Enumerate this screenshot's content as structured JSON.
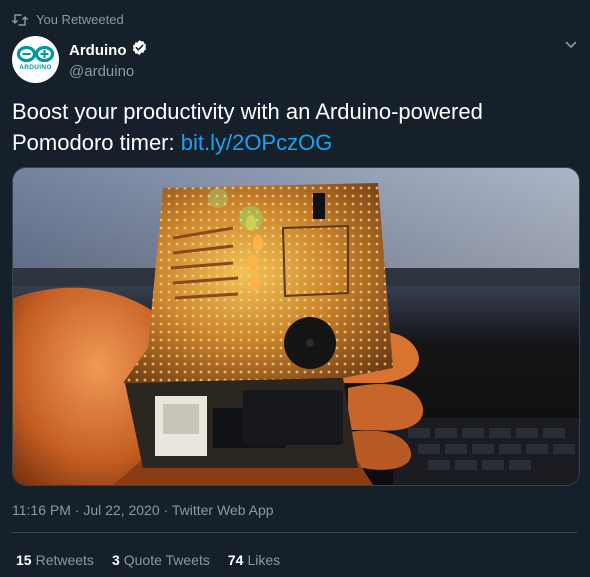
{
  "retweet_context": {
    "text": "You Retweeted",
    "icon": "retweet-icon"
  },
  "author": {
    "display_name": "Arduino",
    "handle": "@arduino",
    "verified": true,
    "avatar_text": "ARDUINO",
    "brand_color": "#00979d"
  },
  "tweet": {
    "text": "Boost your productivity with an Arduino-powered Pomodoro timer: ",
    "link_text": "bit.ly/2OPczOG"
  },
  "meta": {
    "time": "11:16 PM",
    "separator": "·",
    "date": "Jul 22, 2020",
    "source": "Twitter Web App"
  },
  "stats": {
    "retweets": {
      "count": "15",
      "label": "Retweets"
    },
    "quotes": {
      "count": "3",
      "label": "Quote Tweets"
    },
    "likes": {
      "count": "74",
      "label": "Likes"
    }
  },
  "colors": {
    "background": "#15202b",
    "text_secondary": "#8899a6",
    "link": "#1da1f2",
    "border": "#38444d"
  }
}
